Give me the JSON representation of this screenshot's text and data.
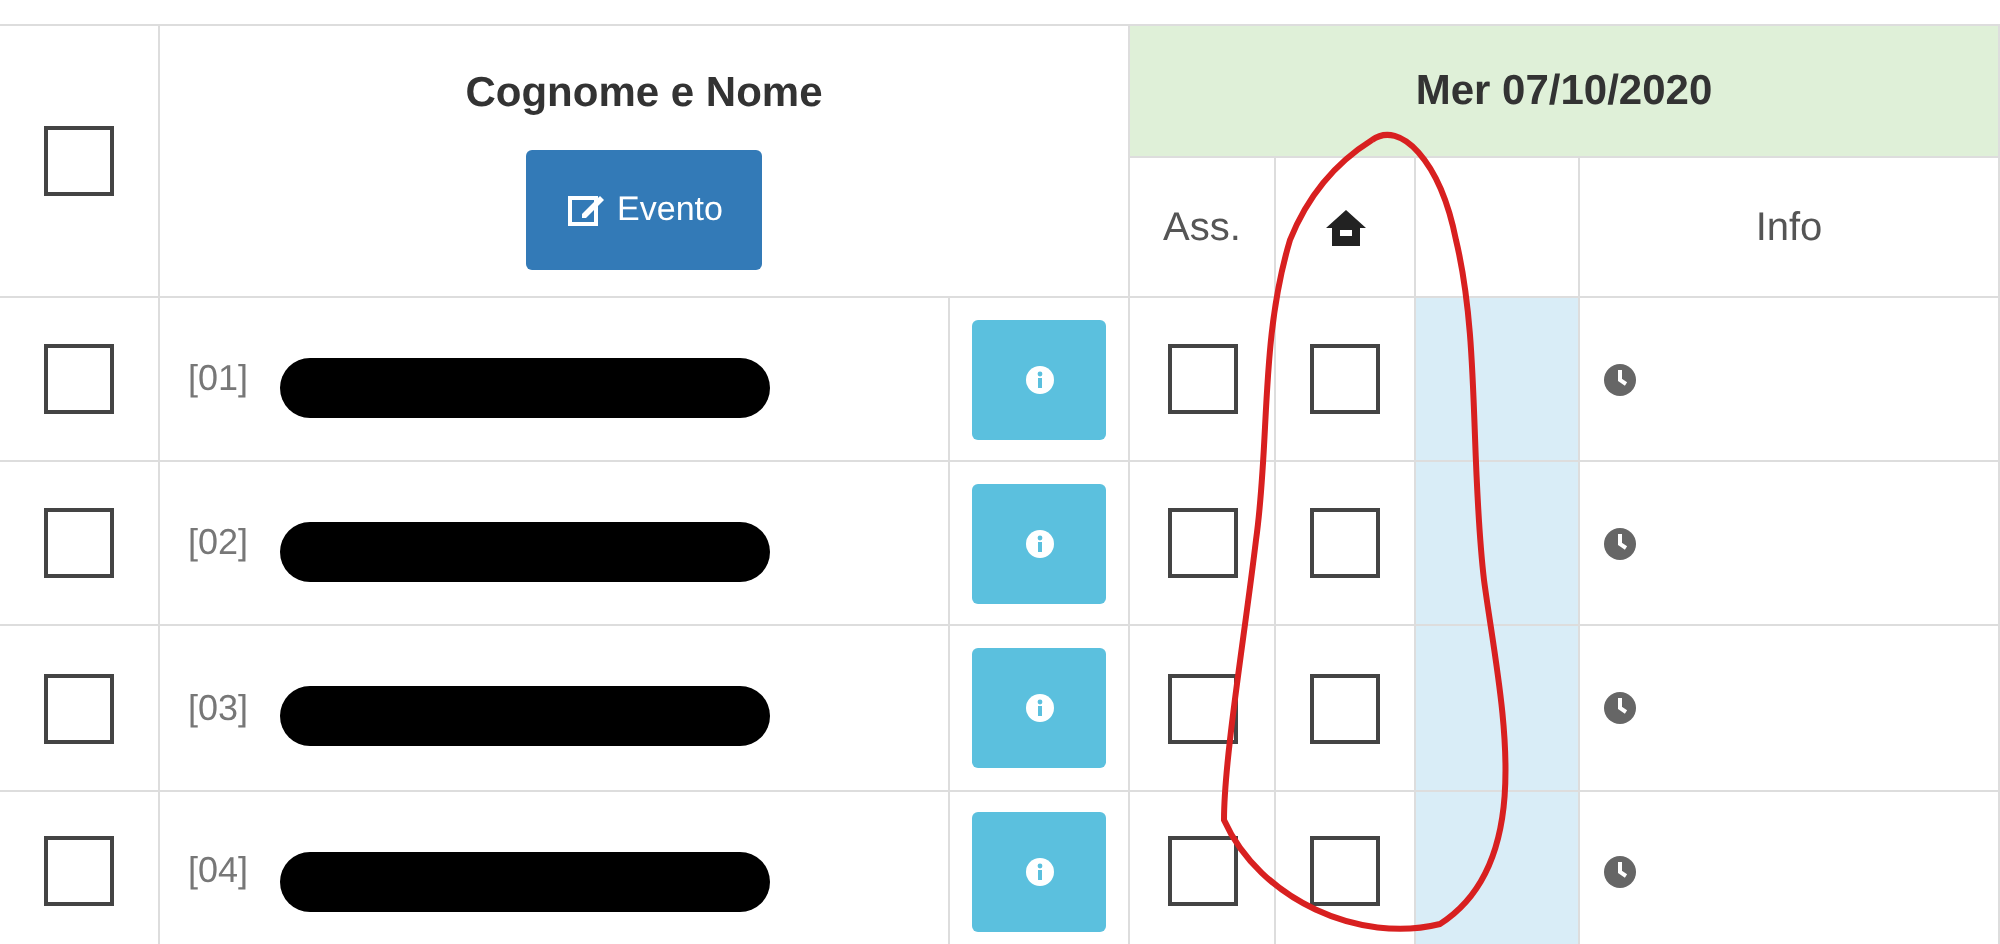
{
  "header": {
    "select_all_checked": false,
    "name_column": "Cognome e Nome",
    "event_button": "Evento",
    "date": "Mer 07/10/2020",
    "subcolumns": [
      "Ass.",
      "Info"
    ]
  },
  "rows": [
    {
      "code": "[01]",
      "selected": false,
      "absent": false,
      "home": false
    },
    {
      "code": "[02]",
      "selected": false,
      "absent": false,
      "home": false
    },
    {
      "code": "[03]",
      "selected": false,
      "absent": false,
      "home": false
    },
    {
      "code": "[04]",
      "selected": false,
      "absent": false,
      "home": false
    }
  ]
}
